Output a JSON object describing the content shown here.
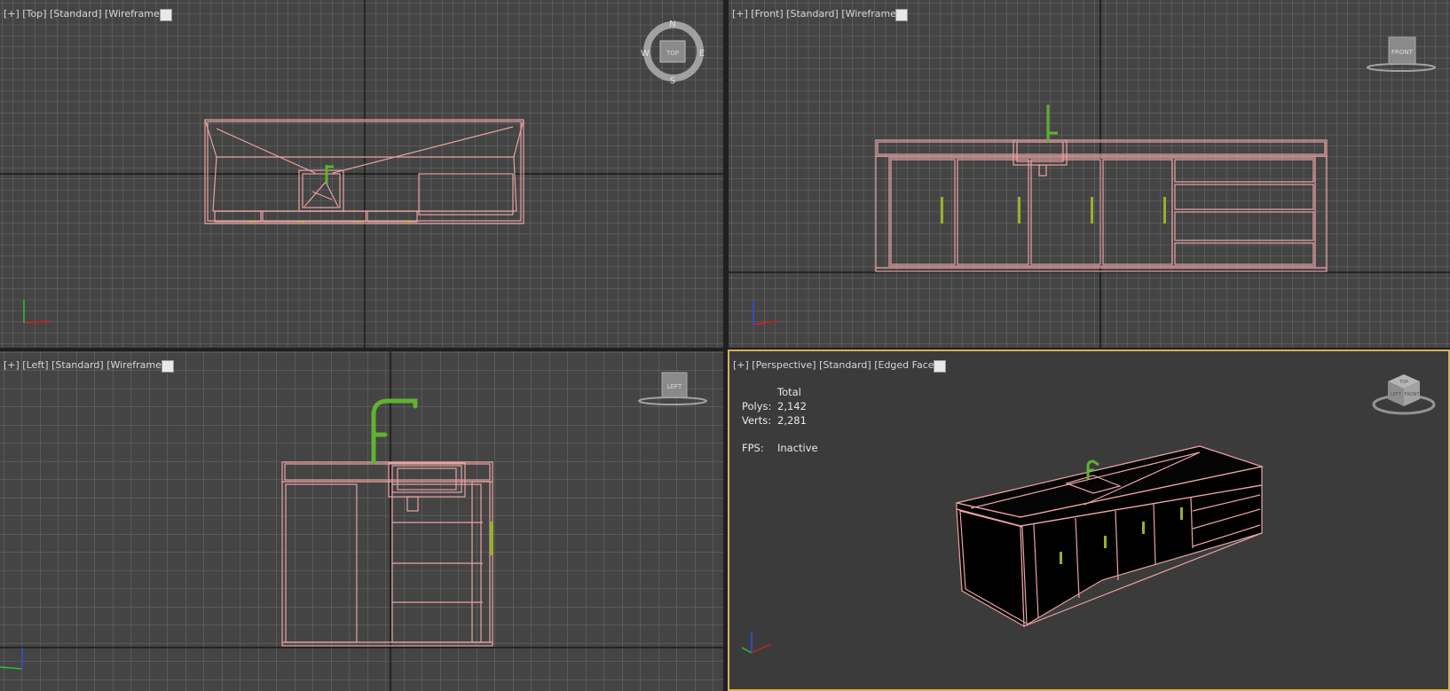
{
  "viewports": {
    "top": {
      "label": "[+] [Top] [Standard] [Wireframe]"
    },
    "front": {
      "label": "[+] [Front] [Standard] [Wireframe]"
    },
    "left": {
      "label": "[+] [Left] [Standard] [Wireframe]"
    },
    "persp": {
      "label": "[+] [Perspective] [Standard] [Edged Faces]"
    }
  },
  "compass": {
    "n": "N",
    "s": "S",
    "e": "E",
    "w": "W",
    "cube_face": "TOP"
  },
  "viewcube_labels": {
    "front": "FRONT",
    "left": "LEFT",
    "persp_top": "TOP",
    "persp_front": "FRONT",
    "persp_left": "LEFT"
  },
  "stats": {
    "header": "Total",
    "polys_label": "Polys:",
    "polys": "2,142",
    "verts_label": "Verts:",
    "verts": "2,281",
    "fps_label": "FPS:",
    "fps": "Inactive"
  },
  "colors": {
    "wire": "#e9a3a3",
    "faucet": "#5fb32e",
    "handle": "#9ab02a",
    "grid": "#7a7a7a",
    "background": "#454545",
    "active_border": "#d2b45a"
  }
}
